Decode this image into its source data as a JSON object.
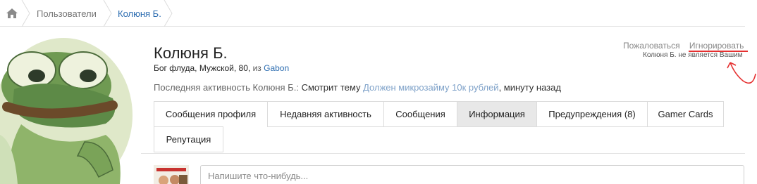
{
  "breadcrumb": {
    "home_icon": "home-icon",
    "items": [
      "Пользователи",
      "Колюня Б."
    ]
  },
  "profile": {
    "name": "Колюня Б.",
    "title_prefix": "Бог флуда, Мужской, 80, ",
    "from_word": "из",
    "location": "Gabon",
    "activity_label": "Последняя активность Колюня Б.:",
    "activity_action": "Смотрит тему",
    "activity_topic": "Должен микрозайму 10к рублей",
    "activity_time": ", минуту назад"
  },
  "actions": {
    "report": "Пожаловаться",
    "ignore": "Игнорировать",
    "note": "Колюня Б. не является Вашим"
  },
  "tabs": [
    "Сообщения профиля",
    "Недавняя активность",
    "Сообщения",
    "Информация",
    "Предупреждения (8)",
    "Gamer Cards",
    "Репутация"
  ],
  "composer": {
    "placeholder": "Напишите что-нибудь..."
  },
  "colors": {
    "accent": "#2b6cb0",
    "annotation": "#e53030",
    "tab_selected_bg": "#e8e8e8"
  }
}
